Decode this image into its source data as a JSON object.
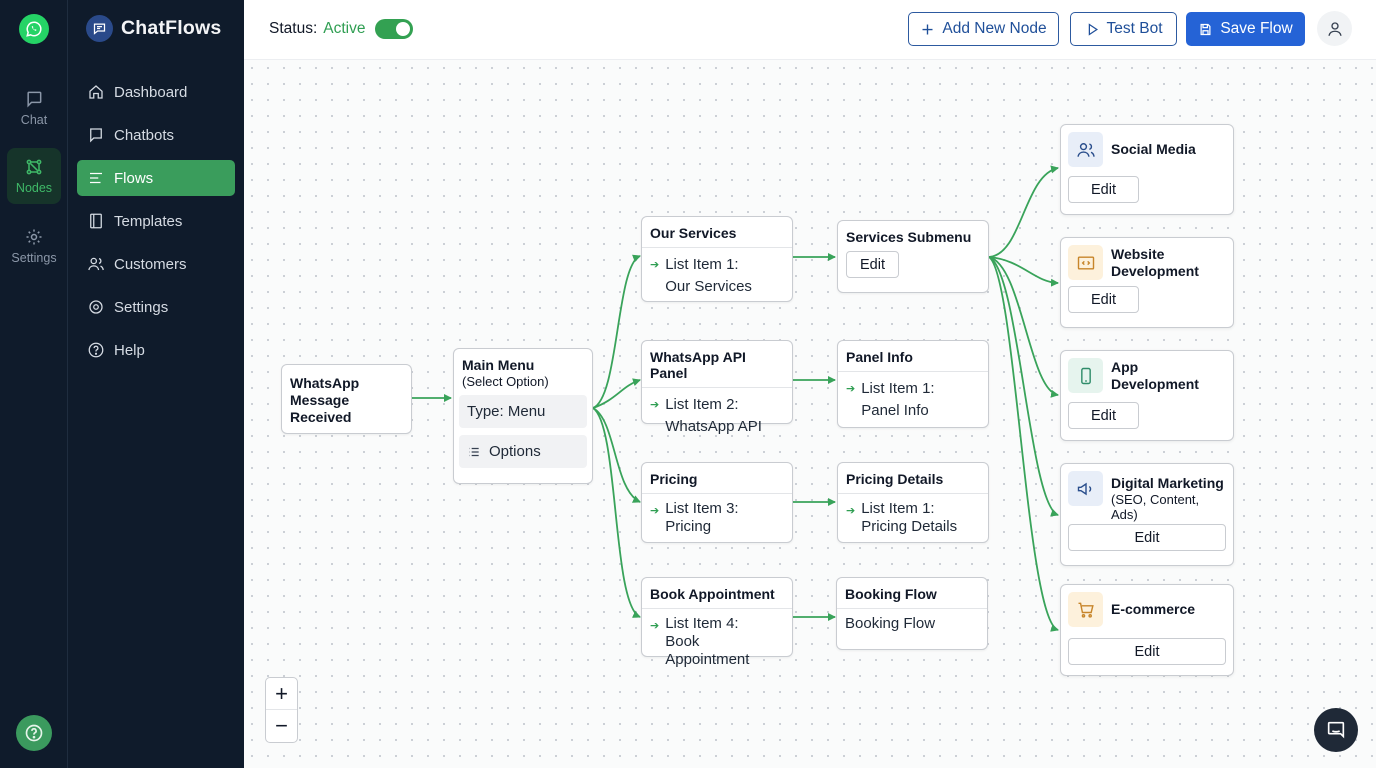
{
  "app": {
    "name": "ChatFlows"
  },
  "rail": {
    "items": [
      {
        "label": "Chat"
      },
      {
        "label": "Nodes"
      },
      {
        "label": "Settings"
      }
    ]
  },
  "sidebar": {
    "items": [
      {
        "label": "Dashboard"
      },
      {
        "label": "Chatbots"
      },
      {
        "label": "Flows"
      },
      {
        "label": "Templates"
      },
      {
        "label": "Customers"
      },
      {
        "label": "Settings"
      },
      {
        "label": "Help"
      }
    ]
  },
  "topbar": {
    "status_label": "Status:",
    "status_value": "Active",
    "add_node": "Add New Node",
    "test_bot": "Test Bot",
    "save_flow": "Save Flow"
  },
  "colors": {
    "accent_green": "#3a9d5c",
    "primary_blue": "#2563d6",
    "sidebar_bg": "#0f1b2b"
  },
  "flow": {
    "trigger": {
      "title": "WhatsApp Message Received"
    },
    "main_menu": {
      "title": "Main Menu",
      "subtitle": "(Select Option)",
      "type": "Type: Menu",
      "options": "Options"
    },
    "menu_items": [
      {
        "title": "Our Services",
        "item": "List Item 1:",
        "value": "Our Services"
      },
      {
        "title": "WhatsApp API Panel",
        "item": "List Item 2:",
        "value": "WhatsApp API"
      },
      {
        "title": "Pricing",
        "item": "List Item 3:",
        "value": "Pricing"
      },
      {
        "title": "Book Appointment",
        "item": "List Item 4:",
        "value": "Book Appointment"
      }
    ],
    "services_submenu": {
      "title": "Services Submenu",
      "edit": "Edit"
    },
    "panel_info": {
      "title": "Panel Info",
      "item": "List Item 1:",
      "value": "Panel Info"
    },
    "pricing_details": {
      "title": "Pricing Details",
      "item": "List Item 1:",
      "value": "Pricing Details"
    },
    "booking_flow": {
      "title": "Booking Flow",
      "body": "Booking Flow"
    },
    "services": [
      {
        "title": "Social Media",
        "subtitle": "",
        "icon": "users-icon",
        "edit": "Edit"
      },
      {
        "title": "Website Development",
        "subtitle": "",
        "icon": "code-icon",
        "edit": "Edit"
      },
      {
        "title": "App Development",
        "subtitle": "",
        "icon": "smartphone-icon",
        "edit": "Edit"
      },
      {
        "title": "Digital Marketing",
        "subtitle": "(SEO, Content, Ads)",
        "icon": "megaphone-icon",
        "edit": "Edit"
      },
      {
        "title": "E-commerce",
        "subtitle": "",
        "icon": "cart-icon",
        "edit": "Edit"
      }
    ]
  }
}
